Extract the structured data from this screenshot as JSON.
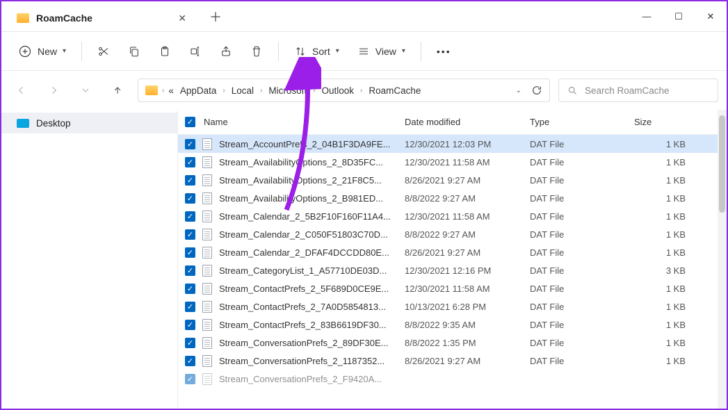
{
  "tab": {
    "title": "RoamCache"
  },
  "toolbar": {
    "new_label": "New",
    "sort_label": "Sort",
    "view_label": "View"
  },
  "breadcrumbs": [
    "AppData",
    "Local",
    "Microsoft",
    "Outlook",
    "RoamCache"
  ],
  "search": {
    "placeholder": "Search RoamCache"
  },
  "sidebar": {
    "items": [
      {
        "label": "Desktop"
      }
    ]
  },
  "columns": {
    "name": "Name",
    "date": "Date modified",
    "type": "Type",
    "size": "Size"
  },
  "files": [
    {
      "name": "Stream_AccountPrefs_2_04B1F3DA9FE...",
      "date": "12/30/2021 12:03 PM",
      "type": "DAT File",
      "size": "1 KB",
      "selected": true
    },
    {
      "name": "Stream_AvailabilityOptions_2_8D35FC...",
      "date": "12/30/2021 11:58 AM",
      "type": "DAT File",
      "size": "1 KB"
    },
    {
      "name": "Stream_AvailabilityOptions_2_21F8C5...",
      "date": "8/26/2021 9:27 AM",
      "type": "DAT File",
      "size": "1 KB"
    },
    {
      "name": "Stream_AvailabilityOptions_2_B981ED...",
      "date": "8/8/2022 9:27 AM",
      "type": "DAT File",
      "size": "1 KB"
    },
    {
      "name": "Stream_Calendar_2_5B2F10F160F11A4...",
      "date": "12/30/2021 11:58 AM",
      "type": "DAT File",
      "size": "1 KB"
    },
    {
      "name": "Stream_Calendar_2_C050F51803C70D...",
      "date": "8/8/2022 9:27 AM",
      "type": "DAT File",
      "size": "1 KB"
    },
    {
      "name": "Stream_Calendar_2_DFAF4DCCDD80E...",
      "date": "8/26/2021 9:27 AM",
      "type": "DAT File",
      "size": "1 KB"
    },
    {
      "name": "Stream_CategoryList_1_A57710DE03D...",
      "date": "12/30/2021 12:16 PM",
      "type": "DAT File",
      "size": "3 KB"
    },
    {
      "name": "Stream_ContactPrefs_2_5F689D0CE9E...",
      "date": "12/30/2021 11:58 AM",
      "type": "DAT File",
      "size": "1 KB"
    },
    {
      "name": "Stream_ContactPrefs_2_7A0D5854813...",
      "date": "10/13/2021 6:28 PM",
      "type": "DAT File",
      "size": "1 KB"
    },
    {
      "name": "Stream_ContactPrefs_2_83B6619DF30...",
      "date": "8/8/2022 9:35 AM",
      "type": "DAT File",
      "size": "1 KB"
    },
    {
      "name": "Stream_ConversationPrefs_2_89DF30E...",
      "date": "8/8/2022 1:35 PM",
      "type": "DAT File",
      "size": "1 KB"
    },
    {
      "name": "Stream_ConversationPrefs_2_1187352...",
      "date": "8/26/2021 9:27 AM",
      "type": "DAT File",
      "size": "1 KB"
    },
    {
      "name": "Stream_ConversationPrefs_2_F9420A...",
      "date": "",
      "type": "",
      "size": ""
    }
  ]
}
